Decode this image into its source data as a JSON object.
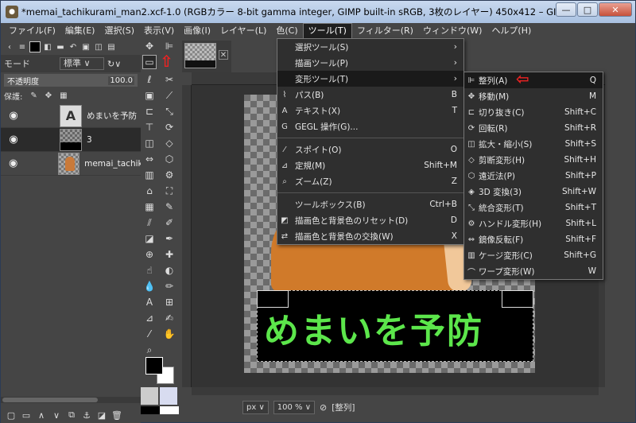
{
  "window": {
    "title": "*memai_tachikurami_man2.xcf-1.0 (RGBカラー 8-bit gamma integer, GIMP built-in sRGB, 3枚のレイヤー) 450x412 – GIMP",
    "min_label": "—",
    "max_label": "□",
    "close_label": "✕"
  },
  "menubar": [
    "ファイル(F)",
    "編集(E)",
    "選択(S)",
    "表示(V)",
    "画像(I)",
    "レイヤー(L)",
    "色(C)",
    "ツール(T)",
    "フィルター(R)",
    "ウィンドウ(W)",
    "ヘルプ(H)"
  ],
  "layers_panel": {
    "mode_label": "モード",
    "mode_value": "標準 ∨",
    "opacity_label": "不透明度",
    "opacity_value": "100.0",
    "lock_label": "保護:",
    "layers": [
      {
        "name": "めまいを予防",
        "thumb": "A"
      },
      {
        "name": "3"
      },
      {
        "name": "memai_tachik"
      }
    ]
  },
  "canvas": {
    "banner_text": "めまいを予防"
  },
  "statusbar": {
    "unit": "px ∨",
    "zoom": "100 % ∨",
    "message": "[整列]"
  },
  "tools_menu": [
    {
      "label": "選択ツール(S)",
      "submenu": true
    },
    {
      "label": "描画ツール(P)",
      "submenu": true
    },
    {
      "label": "変形ツール(T)",
      "submenu": true,
      "highlight": true
    },
    {
      "label": "パス(B)",
      "shortcut": "B",
      "icon": "path-icon"
    },
    {
      "label": "テキスト(X)",
      "shortcut": "T",
      "icon": "text-icon"
    },
    {
      "label": "GEGL 操作(G)...",
      "shortcut": "",
      "icon": "gegl-icon"
    },
    {
      "sep": true
    },
    {
      "label": "スポイト(O)",
      "shortcut": "O",
      "icon": "eyedropper-icon"
    },
    {
      "label": "定規(M)",
      "shortcut": "Shift+M",
      "icon": "ruler-icon"
    },
    {
      "label": "ズーム(Z)",
      "shortcut": "Z",
      "icon": "zoom-icon"
    },
    {
      "sep": true
    },
    {
      "label": "ツールボックス(B)",
      "shortcut": "Ctrl+B"
    },
    {
      "label": "描画色と背景色のリセット(D)",
      "shortcut": "D",
      "icon": "reset-colors-icon"
    },
    {
      "label": "描画色と背景色の交換(W)",
      "shortcut": "X",
      "icon": "swap-colors-icon"
    }
  ],
  "transform_menu": [
    {
      "label": "整列(A)",
      "shortcut": "Q",
      "highlight": true
    },
    {
      "label": "移動(M)",
      "shortcut": "M"
    },
    {
      "label": "切り抜き(C)",
      "shortcut": "Shift+C"
    },
    {
      "label": "回転(R)",
      "shortcut": "Shift+R"
    },
    {
      "label": "拡大・縮小(S)",
      "shortcut": "Shift+S"
    },
    {
      "label": "剪断変形(H)",
      "shortcut": "Shift+H"
    },
    {
      "label": "遠近法(P)",
      "shortcut": "Shift+P"
    },
    {
      "label": "3D 変換(3)",
      "shortcut": "Shift+W"
    },
    {
      "label": "統合変形(T)",
      "shortcut": "Shift+T"
    },
    {
      "label": "ハンドル変形(H)",
      "shortcut": "Shift+L"
    },
    {
      "label": "鏡像反転(F)",
      "shortcut": "Shift+F"
    },
    {
      "label": "ケージ変形(C)",
      "shortcut": "Shift+G"
    },
    {
      "label": "ワープ変形(W)",
      "shortcut": "W"
    }
  ],
  "colors": {
    "banner_text": "#5ce64b",
    "annotation_arrow": "#e22222",
    "shirt": "#d07a2a"
  }
}
